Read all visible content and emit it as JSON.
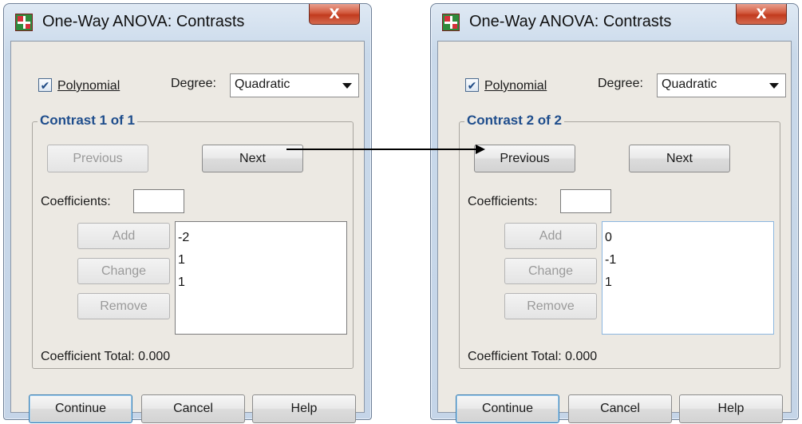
{
  "dialogs": [
    {
      "title": "One-Way ANOVA: Contrasts",
      "close_label": "X",
      "polynomial": {
        "checked": true,
        "label": "Polynomial"
      },
      "degree": {
        "label": "Degree:",
        "value": "Quadratic"
      },
      "contrast_group_title": "Contrast 1 of 1",
      "previous_label": "Previous",
      "previous_enabled": false,
      "next_label": "Next",
      "coefficients_label": "Coefficients:",
      "coefficients_value": "",
      "add_label": "Add",
      "change_label": "Change",
      "remove_label": "Remove",
      "coefficient_list": [
        "-2",
        "1",
        "1"
      ],
      "coefficient_total": "Coefficient Total: 0.000",
      "continue_label": "Continue",
      "cancel_label": "Cancel",
      "help_label": "Help"
    },
    {
      "title": "One-Way ANOVA: Contrasts",
      "close_label": "X",
      "polynomial": {
        "checked": true,
        "label": "Polynomial"
      },
      "degree": {
        "label": "Degree:",
        "value": "Quadratic"
      },
      "contrast_group_title": "Contrast 2 of 2",
      "previous_label": "Previous",
      "previous_enabled": true,
      "next_label": "Next",
      "coefficients_label": "Coefficients:",
      "coefficients_value": "",
      "add_label": "Add",
      "change_label": "Change",
      "remove_label": "Remove",
      "coefficient_list": [
        "0",
        "-1",
        "1"
      ],
      "coefficient_total": "Coefficient Total: 0.000",
      "continue_label": "Continue",
      "cancel_label": "Cancel",
      "help_label": "Help"
    }
  ],
  "icons": {
    "app": "spss-app-icon",
    "close": "close-icon",
    "checkbox_check": "checkmark-icon",
    "dropdown": "chevron-down-icon",
    "connector": "arrow-right-icon"
  },
  "colors": {
    "group_title": "#1e4d8c",
    "close_button": "#c23b1e",
    "window_frame": "#c5d5e8",
    "dialog_body": "#ece9e3"
  }
}
